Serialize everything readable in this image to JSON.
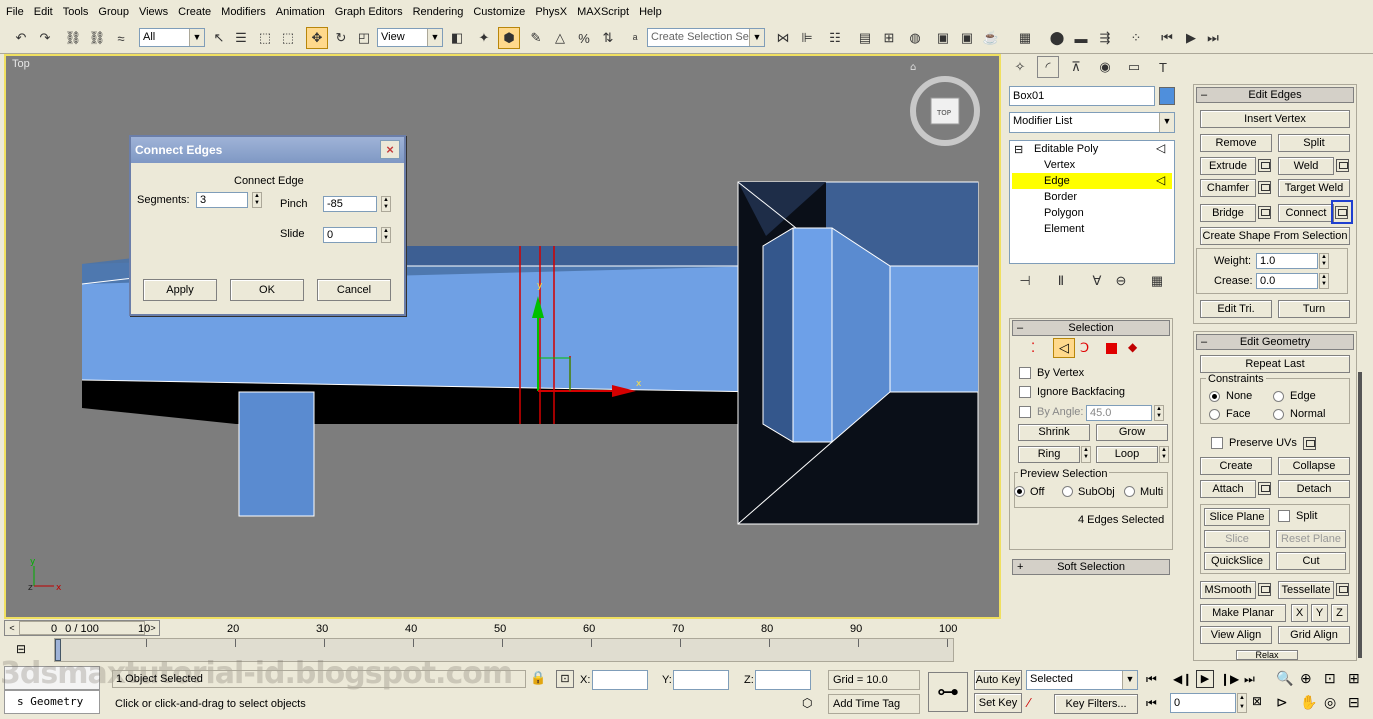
{
  "menu": [
    "File",
    "Edit",
    "Tools",
    "Group",
    "Views",
    "Create",
    "Modifiers",
    "Animation",
    "Graph Editors",
    "Rendering",
    "Customize",
    "PhysX",
    "MAXScript",
    "Help"
  ],
  "toolbar": {
    "filter_value": "All",
    "reference_coord": "View",
    "selection_set_placeholder": "Create Selection Set"
  },
  "viewport": {
    "label": "Top",
    "viewcube_label": "TOP"
  },
  "connect_dialog": {
    "title": "Connect Edges",
    "group_label": "Connect Edge",
    "segments_label": "Segments:",
    "segments_value": "3",
    "pinch_label": "Pinch",
    "pinch_value": "-85",
    "slide_label": "Slide",
    "slide_value": "0",
    "apply": "Apply",
    "ok": "OK",
    "cancel": "Cancel",
    "close": "×"
  },
  "command_panel": {
    "object_name": "Box01",
    "object_color": "#4f8fdc",
    "modifier_list": "Modifier List",
    "stack": [
      "Editable Poly",
      "Vertex",
      "Edge",
      "Border",
      "Polygon",
      "Element"
    ],
    "stack_selected": "Edge",
    "selection": {
      "title": "Selection",
      "by_vertex": "By Vertex",
      "ignore_backfacing": "Ignore Backfacing",
      "by_angle": "By Angle:",
      "by_angle_value": "45.0",
      "shrink": "Shrink",
      "grow": "Grow",
      "ring": "Ring",
      "loop": "Loop",
      "preview_title": "Preview Selection",
      "preview_off": "Off",
      "preview_subobj": "SubObj",
      "preview_multi": "Multi",
      "status": "4 Edges Selected"
    },
    "soft_selection": "Soft Selection"
  },
  "edit_edges": {
    "title": "Edit Edges",
    "insert_vertex": "Insert Vertex",
    "remove": "Remove",
    "split": "Split",
    "extrude": "Extrude",
    "weld": "Weld",
    "chamfer": "Chamfer",
    "target_weld": "Target Weld",
    "bridge": "Bridge",
    "connect": "Connect",
    "create_shape": "Create Shape From Selection",
    "weight_label": "Weight:",
    "weight_value": "1.0",
    "crease_label": "Crease:",
    "crease_value": "0.0",
    "edit_tri": "Edit Tri.",
    "turn": "Turn"
  },
  "edit_geometry": {
    "title": "Edit Geometry",
    "repeat_last": "Repeat Last",
    "constraints": "Constraints",
    "none": "None",
    "edge": "Edge",
    "face": "Face",
    "normal": "Normal",
    "preserve_uvs": "Preserve UVs",
    "create": "Create",
    "collapse": "Collapse",
    "attach": "Attach",
    "detach": "Detach",
    "slice_plane": "Slice Plane",
    "split": "Split",
    "slice": "Slice",
    "reset_plane": "Reset Plane",
    "quickslice": "QuickSlice",
    "cut": "Cut",
    "msmooth": "MSmooth",
    "tessellate": "Tessellate",
    "make_planar": "Make Planar",
    "x": "X",
    "y": "Y",
    "z": "Z",
    "view_align": "View Align",
    "grid_align": "Grid Align",
    "relax": "Relax"
  },
  "timeline": {
    "frame": "0 / 100",
    "ticks": [
      "0",
      "10",
      "20",
      "30",
      "40",
      "50",
      "60",
      "70",
      "80",
      "90",
      "100"
    ]
  },
  "status": {
    "objects_selected": "1 Object Selected",
    "prompt": "Click or click-and-drag to select objects",
    "maxscript": "s Geometry",
    "x_label": "X:",
    "y_label": "Y:",
    "z_label": "Z:",
    "grid": "Grid = 10.0",
    "add_time_tag": "Add Time Tag",
    "auto_key": "Auto Key",
    "set_key": "Set Key",
    "key_mode": "Selected",
    "key_filters": "Key Filters...",
    "current_frame": "0"
  },
  "watermark": "3dsmaxtutorial-id.blogspot.com"
}
